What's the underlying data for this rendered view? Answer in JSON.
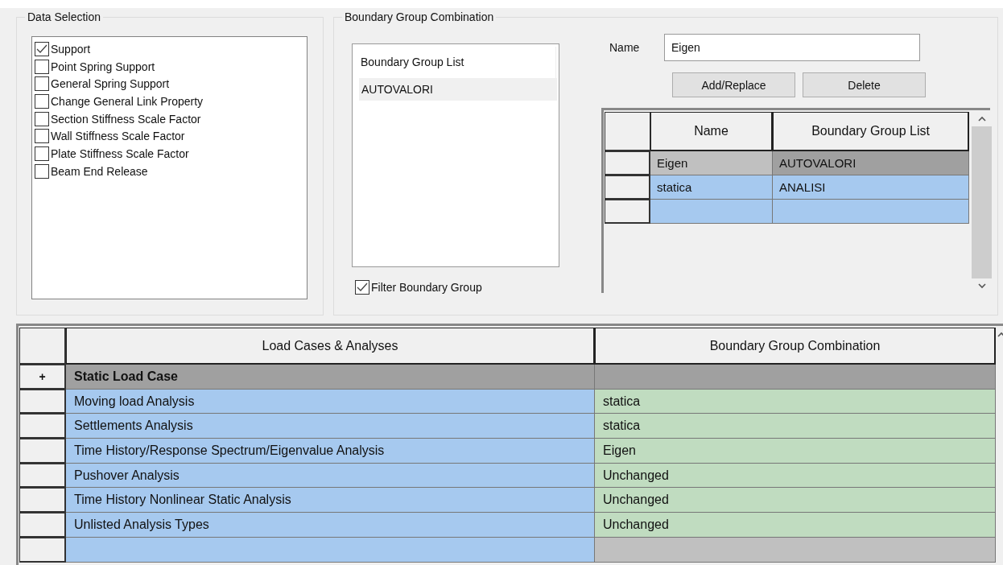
{
  "data_selection": {
    "title": "Data Selection",
    "items": [
      {
        "label": "Support",
        "checked": true
      },
      {
        "label": "Point Spring Support",
        "checked": false
      },
      {
        "label": "General Spring Support",
        "checked": false
      },
      {
        "label": "Change General Link Property",
        "checked": false
      },
      {
        "label": "Section Stiffness Scale Factor",
        "checked": false
      },
      {
        "label": "Wall Stiffness Scale Factor",
        "checked": false
      },
      {
        "label": "Plate Stiffness Scale Factor",
        "checked": false
      },
      {
        "label": "Beam End Release",
        "checked": false
      }
    ]
  },
  "boundary_group_combination": {
    "title": "Boundary Group Combination",
    "list": {
      "header": "Boundary Group List",
      "items": [
        {
          "label": "AUTOVALORI",
          "selected": true
        }
      ]
    },
    "filter": {
      "label": "Filter Boundary Group",
      "checked": true
    },
    "name_label": "Name",
    "name_value": "Eigen",
    "buttons": [
      "Add/Replace",
      "Delete"
    ],
    "table": {
      "columns": [
        "Name",
        "Boundary Group List"
      ],
      "rows": [
        {
          "kind": "entry",
          "selected": true,
          "name": "Eigen",
          "group": "AUTOVALORI"
        },
        {
          "kind": "entry",
          "selected": false,
          "name": "statica",
          "group": "ANALISI"
        },
        {
          "kind": "new"
        }
      ]
    }
  },
  "assignment_table": {
    "columns": [
      "Load Cases & Analyses",
      "Boundary Group Combination"
    ],
    "rows": [
      {
        "kind": "group",
        "toggle": "+",
        "label": "Static Load Case"
      },
      {
        "kind": "item",
        "analysis": "Moving load Analysis",
        "combination": "statica"
      },
      {
        "kind": "item",
        "analysis": "Settlements Analysis",
        "combination": "statica"
      },
      {
        "kind": "item",
        "analysis": "Time History/Response Spectrum/Eigenvalue Analysis",
        "combination": "Eigen"
      },
      {
        "kind": "item",
        "analysis": "Pushover Analysis",
        "combination": "Unchanged"
      },
      {
        "kind": "item",
        "analysis": "Time History Nonlinear Static Analysis",
        "combination": "Unchanged"
      },
      {
        "kind": "item",
        "analysis": "Unlisted Analysis Types",
        "combination": "Unchanged"
      },
      {
        "kind": "new"
      }
    ]
  }
}
